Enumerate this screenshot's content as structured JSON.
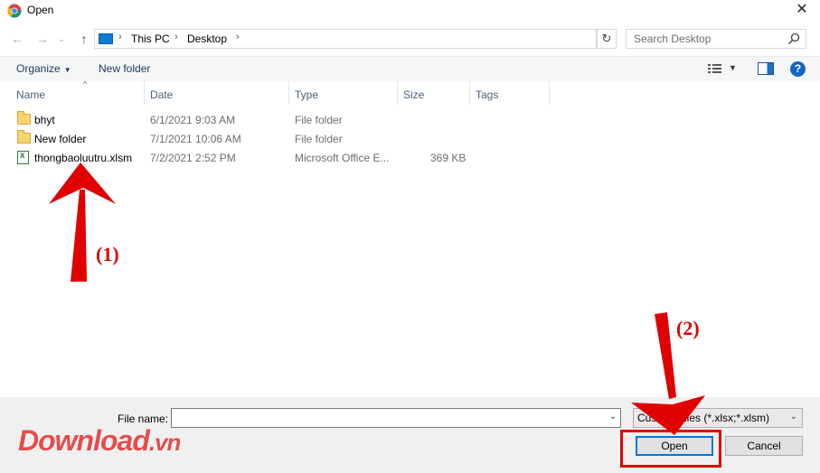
{
  "window": {
    "title": "Open",
    "app_icon": "chrome-icon",
    "close_icon": "close-icon"
  },
  "nav": {
    "back_icon": "arrow-left-icon",
    "forward_icon": "arrow-right-icon",
    "recent_icon": "chevron-down-icon",
    "up_icon": "arrow-up-icon",
    "breadcrumbs": [
      "This PC",
      "Desktop"
    ],
    "refresh_icon": "refresh-icon",
    "search_placeholder": "Search Desktop"
  },
  "toolbar": {
    "organize_label": "Organize",
    "new_folder_label": "New folder",
    "help_label": "?"
  },
  "columns": [
    "Name",
    "Date",
    "Type",
    "Size",
    "Tags"
  ],
  "files": [
    {
      "name": "bhyt",
      "date": "6/1/2021 9:03 AM",
      "type": "File folder",
      "size": "",
      "icon": "folder-icon"
    },
    {
      "name": "New folder",
      "date": "7/1/2021 10:06 AM",
      "type": "File folder",
      "size": "",
      "icon": "folder-icon"
    },
    {
      "name": "thongbaoluutru.xlsm",
      "date": "7/2/2021 2:52 PM",
      "type": "Microsoft Office E...",
      "size": "369 KB",
      "icon": "excel-file-icon"
    }
  ],
  "footer": {
    "file_name_label": "File name:",
    "file_name_value": "",
    "filter_value": "Custom Files (*.xlsx;*.xlsm)",
    "open_label": "Open",
    "cancel_label": "Cancel"
  },
  "annotations": {
    "step1": "(1)",
    "step2": "(2)",
    "color": "#e00000"
  },
  "watermark": {
    "brand": "Download",
    "suffix": ".vn"
  }
}
